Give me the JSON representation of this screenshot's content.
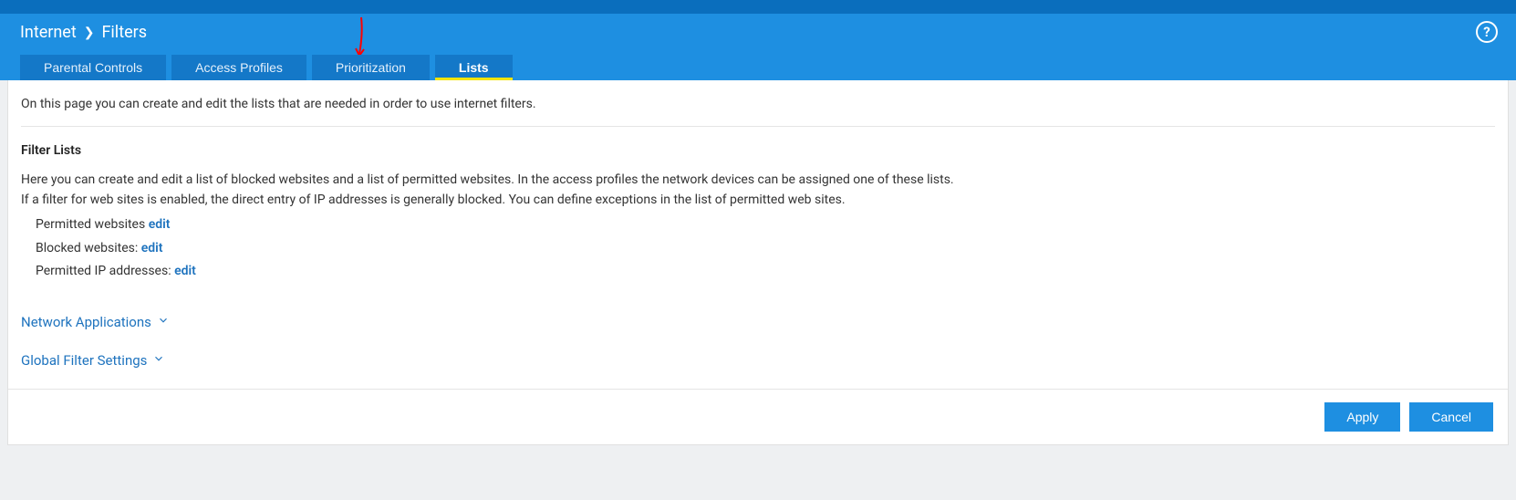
{
  "breadcrumb": {
    "root": "Internet",
    "current": "Filters"
  },
  "tabs": [
    {
      "label": "Parental Controls",
      "active": false
    },
    {
      "label": "Access Profiles",
      "active": false
    },
    {
      "label": "Prioritization",
      "active": false
    },
    {
      "label": "Lists",
      "active": true
    }
  ],
  "intro": "On this page you can create and edit the lists that are needed in order to use internet filters.",
  "filter_lists": {
    "title": "Filter Lists",
    "desc1": "Here you can create and edit a list of blocked websites and a list of permitted websites. In the access profiles the network devices can be assigned one of these lists.",
    "desc2": "If a filter for web sites is enabled, the direct entry of IP addresses is generally blocked. You can define exceptions in the list of permitted web sites.",
    "items": [
      {
        "label": "Permitted websites ",
        "link": "edit"
      },
      {
        "label": "Blocked websites: ",
        "link": "edit"
      },
      {
        "label": "Permitted IP addresses: ",
        "link": "edit"
      }
    ]
  },
  "collapsibles": [
    {
      "label": "Network Applications"
    },
    {
      "label": "Global Filter Settings"
    }
  ],
  "buttons": {
    "apply": "Apply",
    "cancel": "Cancel"
  },
  "help_tooltip": "?"
}
